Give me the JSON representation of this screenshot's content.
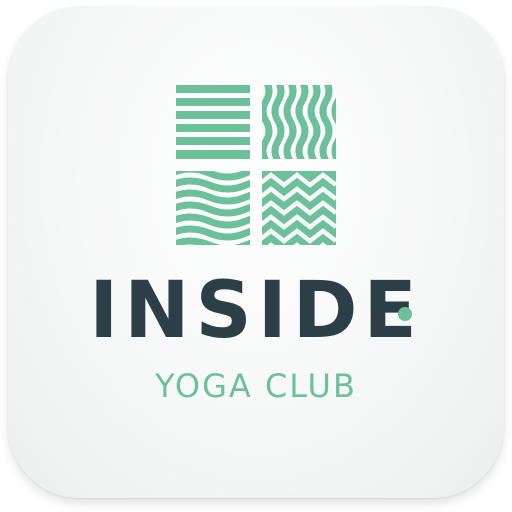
{
  "app": {
    "name": "INSIDE",
    "tagline": "YOGA CLUB"
  },
  "icons": {
    "logo": "four-square-pattern-logo-icon"
  },
  "colors": {
    "accent": "#6cc19a",
    "text_dark": "#2c3f47",
    "background": "#f6f7f7"
  }
}
